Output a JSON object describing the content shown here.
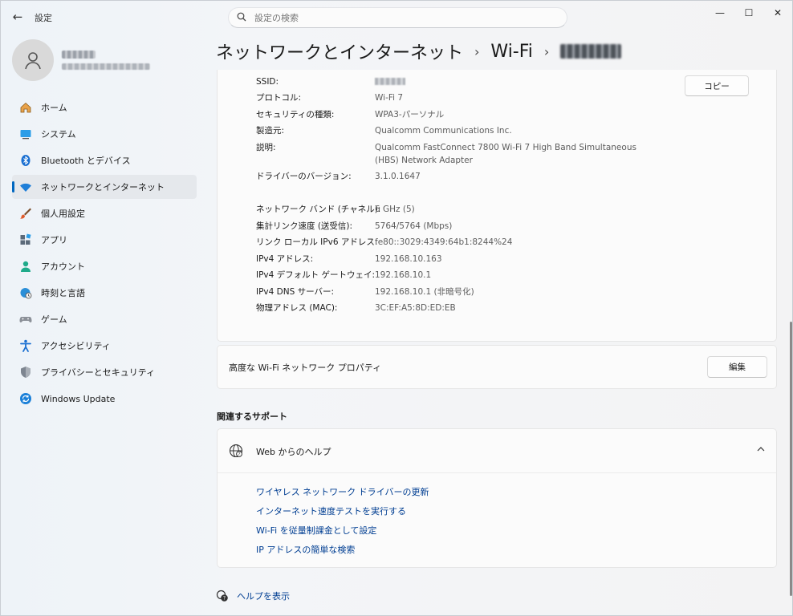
{
  "window": {
    "app_title": "設定",
    "back_glyph": "←",
    "minimize_glyph": "—",
    "maximize_glyph": "☐",
    "close_glyph": "✕"
  },
  "search": {
    "placeholder": "設定の検索"
  },
  "sidebar": {
    "items": [
      {
        "label": "ホーム",
        "icon": "home-icon"
      },
      {
        "label": "システム",
        "icon": "system-icon"
      },
      {
        "label": "Bluetooth とデバイス",
        "icon": "bluetooth-icon"
      },
      {
        "label": "ネットワークとインターネット",
        "icon": "wifi-icon",
        "active": true
      },
      {
        "label": "個人用設定",
        "icon": "brush-icon"
      },
      {
        "label": "アプリ",
        "icon": "apps-icon"
      },
      {
        "label": "アカウント",
        "icon": "person-icon"
      },
      {
        "label": "時刻と言語",
        "icon": "globe-clock-icon"
      },
      {
        "label": "ゲーム",
        "icon": "gamepad-icon"
      },
      {
        "label": "アクセシビリティ",
        "icon": "accessibility-icon"
      },
      {
        "label": "プライバシーとセキュリティ",
        "icon": "shield-icon"
      },
      {
        "label": "Windows Update",
        "icon": "update-icon"
      }
    ]
  },
  "header": {
    "crumb1": "ネットワークとインターネット",
    "crumb2": "Wi-Fi",
    "separator": "›"
  },
  "properties": {
    "copy_button": "コピー",
    "rows": [
      {
        "label": "SSID:",
        "value": ""
      },
      {
        "label": "プロトコル:",
        "value": "Wi-Fi 7"
      },
      {
        "label": "セキュリティの種類:",
        "value": "WPA3-パーソナル"
      },
      {
        "label": "製造元:",
        "value": "Qualcomm Communications Inc."
      },
      {
        "label": "説明:",
        "value": "Qualcomm FastConnect 7800 Wi-Fi 7 High Band Simultaneous (HBS) Network Adapter"
      },
      {
        "label": "ドライバーのバージョン:",
        "value": "3.1.0.1647"
      },
      {
        "label": "ネットワーク バンド (チャネル):",
        "value": "6 GHz (5)"
      },
      {
        "label": "集計リンク速度 (送受信):",
        "value": "5764/5764 (Mbps)"
      },
      {
        "label": "リンク ローカル IPv6 アドレス:",
        "value": "fe80::3029:4349:64b1:8244%24"
      },
      {
        "label": "IPv4 アドレス:",
        "value": "192.168.10.163"
      },
      {
        "label": "IPv4 デフォルト ゲートウェイ:",
        "value": "192.168.10.1"
      },
      {
        "label": "IPv4 DNS サーバー:",
        "value": "192.168.10.1 (非暗号化)"
      },
      {
        "label": "物理アドレス (MAC):",
        "value": "3C:EF:A5:8D:ED:EB"
      }
    ]
  },
  "advanced": {
    "label": "高度な Wi-Fi ネットワーク プロパティ",
    "edit_button": "編集"
  },
  "related_support": {
    "title": "関連するサポート",
    "help_header": "Web からのヘルプ",
    "links": [
      "ワイヤレス ネットワーク ドライバーの更新",
      "インターネット速度テストを実行する",
      "Wi-Fi を従量制課金として設定",
      "IP アドレスの簡単な検索"
    ]
  },
  "footer": {
    "get_help": "ヘルプを表示"
  }
}
